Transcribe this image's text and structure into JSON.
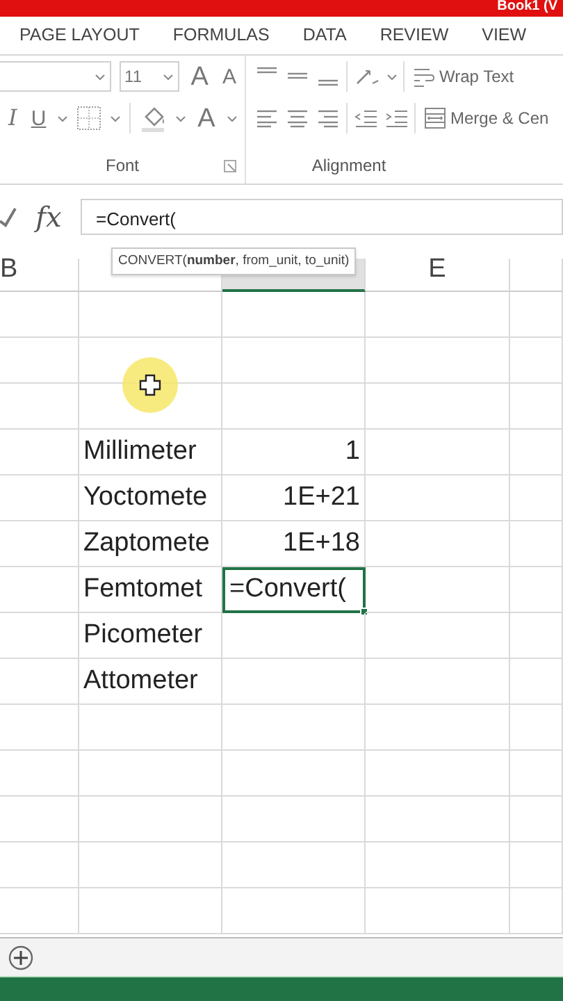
{
  "title_bar": {
    "title": "Book1 (V"
  },
  "ribbon_tabs": [
    {
      "label": "PAGE LAYOUT",
      "selected": false
    },
    {
      "label": "FORMULAS",
      "selected": false
    },
    {
      "label": "DATA",
      "selected": false
    },
    {
      "label": "REVIEW",
      "selected": false
    },
    {
      "label": "VIEW",
      "selected": false
    }
  ],
  "font_group": {
    "label": "Font",
    "font_size": "11",
    "grow_font": "A",
    "shrink_font": "A",
    "italic": "I",
    "underline": "U",
    "font_color": "A"
  },
  "alignment_group": {
    "label": "Alignment",
    "wrap_text": "Wrap Text",
    "merge": "Merge & Cen"
  },
  "formula_bar": {
    "function_symbol": "fx",
    "value": "=Convert("
  },
  "tooltip": "CONVERT(**number**, from_unit, to_unit)",
  "columns": [
    {
      "label": "B",
      "selected": false
    },
    {
      "selected": false
    },
    {
      "selected": true
    },
    {
      "label": "E",
      "selected": false
    },
    {
      "selected": false
    }
  ],
  "rows": [
    {
      "selected": false
    },
    {
      "selected": false
    },
    {
      "selected": false
    },
    {
      "name": "Millimeter",
      "value": "1",
      "selected": false
    },
    {
      "name": "Yoctomete",
      "value": "1E+21",
      "selected": false
    },
    {
      "name": "Zaptomete",
      "value": "1E+18",
      "selected": false
    },
    {
      "name": "Femtomet",
      "value": "=Convert(",
      "selected": true
    },
    {
      "name": "Picometer",
      "selected": false
    },
    {
      "name": "Attometer",
      "selected": false
    },
    {
      "selected": false
    },
    {
      "selected": false
    },
    {
      "selected": false
    },
    {
      "selected": false
    },
    {
      "selected": false
    }
  ]
}
